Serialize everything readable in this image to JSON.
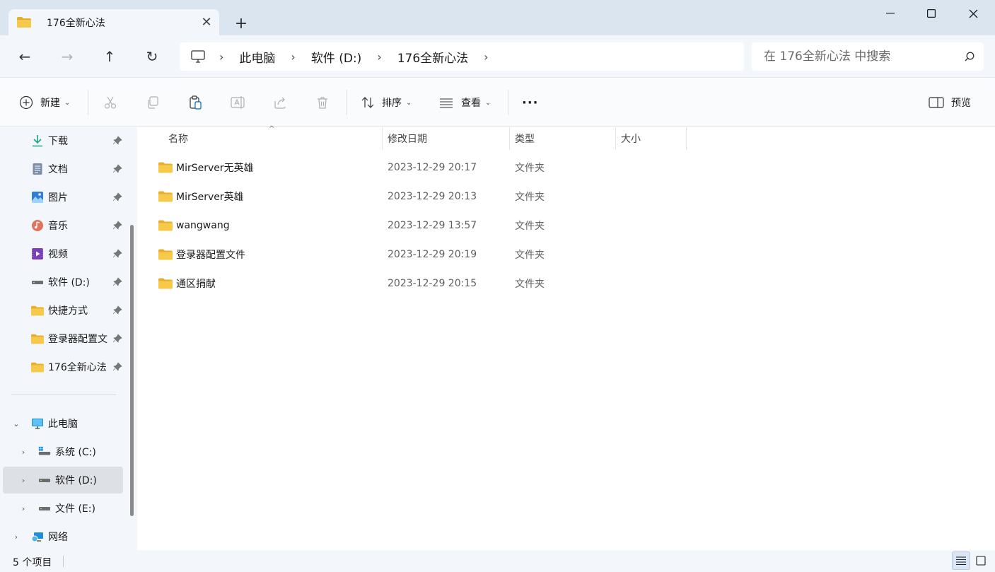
{
  "tab": {
    "title": "176全新心法",
    "close": "✕",
    "new_tab": "+"
  },
  "window": {
    "minimize": "—",
    "close": "✕"
  },
  "nav": {
    "back": "←",
    "forward": "→",
    "up": "↑",
    "refresh": "↻",
    "breadcrumbs": [
      "此电脑",
      "软件 (D:)",
      "176全新心法"
    ],
    "separator": "›",
    "search_placeholder": "在 176全新心法 中搜索"
  },
  "toolbar": {
    "new_label": "新建",
    "sort_label": "排序",
    "view_label": "查看",
    "more_label": "···",
    "preview_label": "预览"
  },
  "sidebar": {
    "quick_access": [
      {
        "label": "下载",
        "icon": "download-icon"
      },
      {
        "label": "文档",
        "icon": "document-icon"
      },
      {
        "label": "图片",
        "icon": "pictures-icon"
      },
      {
        "label": "音乐",
        "icon": "music-icon"
      },
      {
        "label": "视频",
        "icon": "video-icon"
      },
      {
        "label": "软件 (D:)",
        "icon": "drive-icon"
      },
      {
        "label": "快捷方式",
        "icon": "folder-icon"
      },
      {
        "label": "登录器配置文",
        "icon": "folder-icon"
      },
      {
        "label": "176全新心法",
        "icon": "folder-icon"
      }
    ],
    "this_pc": "此电脑",
    "drives": [
      {
        "label": "系统 (C:)"
      },
      {
        "label": "软件 (D:)"
      },
      {
        "label": "文件 (E:)"
      }
    ],
    "network": "网络"
  },
  "columns": {
    "name": "名称",
    "date": "修改日期",
    "type": "类型",
    "size": "大小"
  },
  "files": [
    {
      "name": "MirServer无英雄",
      "date": "2023-12-29 20:17",
      "type": "文件夹"
    },
    {
      "name": "MirServer英雄",
      "date": "2023-12-29 20:13",
      "type": "文件夹"
    },
    {
      "name": "wangwang",
      "date": "2023-12-29 13:57",
      "type": "文件夹"
    },
    {
      "name": "登录器配置文件",
      "date": "2023-12-29 20:19",
      "type": "文件夹"
    },
    {
      "name": "通区捐献",
      "date": "2023-12-29 20:15",
      "type": "文件夹"
    }
  ],
  "status": {
    "item_count": "5 个项目"
  },
  "colors": {
    "folder": "#f7c94b",
    "folder_dark": "#e8ad2a",
    "accent": "#0067c0"
  }
}
